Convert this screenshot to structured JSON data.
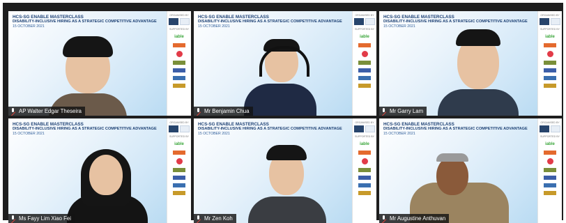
{
  "banner": {
    "line1": "HCS-SG ENABLE MASTERCLASS",
    "line2": "DISABILITY-INCLUSIVE HIRING AS A STRATEGIC COMPETITIVE ADVANTAGE",
    "line3": "15 OCTOBER 2021"
  },
  "sponsor": {
    "organised_by": "ORGANISED BY",
    "supported_by": "SUPPORTED BY",
    "able_logo": "iable"
  },
  "participants": [
    {
      "name": "AP Walter Edgar Theseira",
      "muted": true,
      "active": false
    },
    {
      "name": "Mr Benjamin Chua",
      "muted": true,
      "active": false
    },
    {
      "name": "Mr Garry Lam",
      "muted": true,
      "active": false
    },
    {
      "name": "Ms Fayy Lim Xiao Fei",
      "muted": true,
      "active": false
    },
    {
      "name": "Mr Zen Koh",
      "muted": true,
      "active": false
    },
    {
      "name": "Mr Augustine Anthuvan",
      "muted": true,
      "active": true
    }
  ],
  "colors": {
    "active_border": "#c9f23a",
    "banner_text": "#1b3f73",
    "muted_icon": "#e0433a"
  }
}
